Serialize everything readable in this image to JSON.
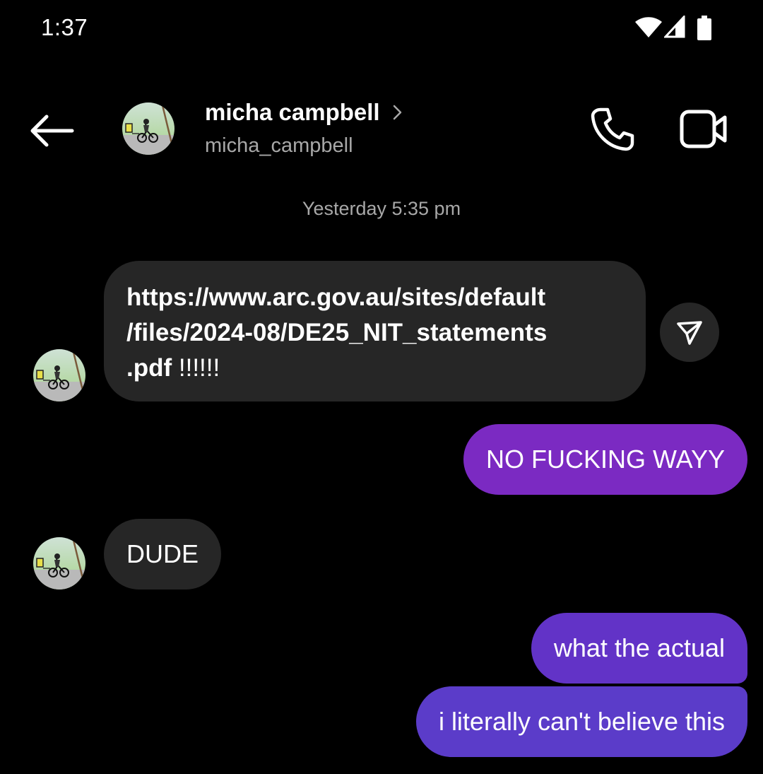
{
  "status_bar": {
    "time": "1:37",
    "icons": [
      "wifi-icon",
      "cellular-signal-icon",
      "battery-icon"
    ]
  },
  "header": {
    "contact_name": "micha campbell",
    "contact_handle": "micha_campbell",
    "icons": [
      "back-arrow-icon",
      "chevron-right-icon",
      "phone-icon",
      "video-camera-icon"
    ]
  },
  "conversation": {
    "timestamp": "Yesterday 5:35 pm",
    "messages": [
      {
        "sender": "contact",
        "lines": [
          "https://www.arc.gov.au/sites/default",
          "/files/2024-08/DE25_NIT_statements",
          ".pdf"
        ],
        "suffix": " !!!!!!"
      },
      {
        "sender": "me",
        "text": "NO FUCKING WAYY"
      },
      {
        "sender": "contact",
        "text": "DUDE"
      },
      {
        "sender": "me",
        "text": "what the actual"
      },
      {
        "sender": "me",
        "text": "i literally can't believe this"
      }
    ]
  },
  "colors": {
    "background": "#000000",
    "incoming_bubble": "#262626",
    "outgoing_bubble_1": "#7b2ac2",
    "outgoing_bubble_2": "#6233c7",
    "outgoing_bubble_3": "#5b3cc9",
    "secondary_text": "#a8a8a8"
  }
}
